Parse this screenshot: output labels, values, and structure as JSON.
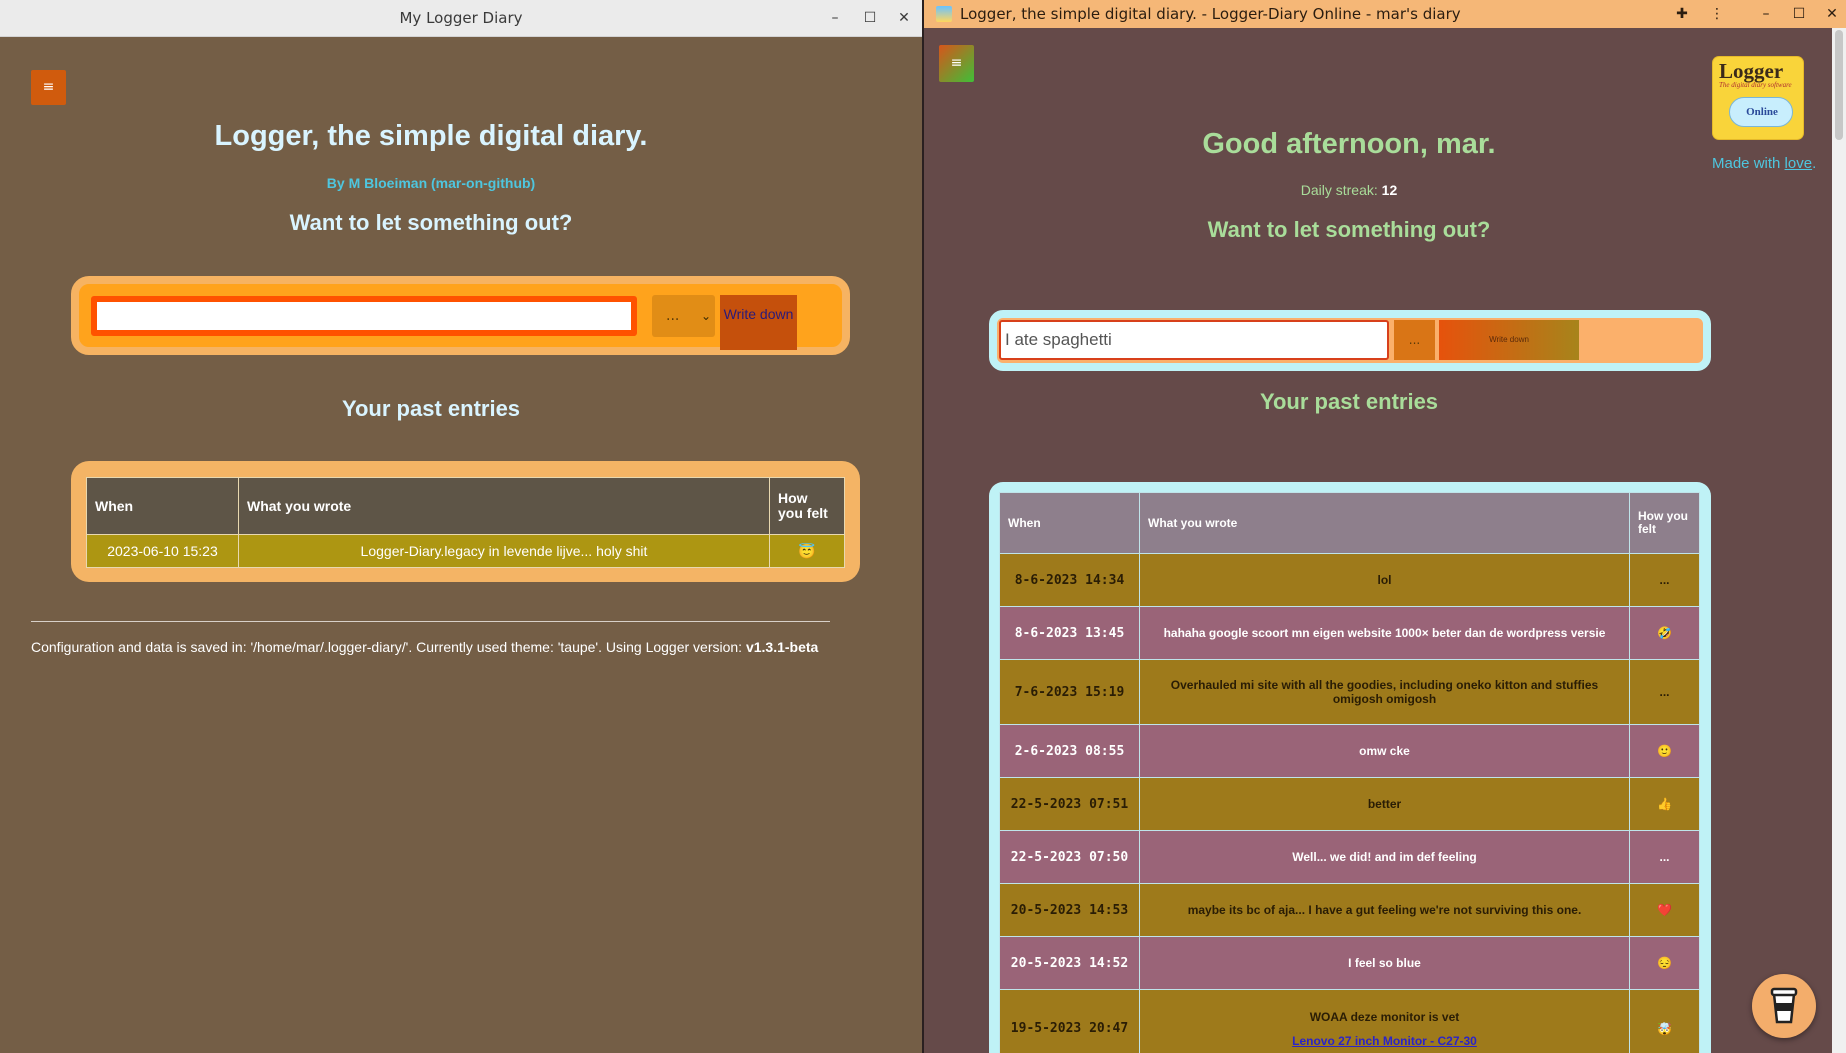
{
  "left_window": {
    "title": "My Logger Diary",
    "controls": {
      "minimize": "–",
      "maximize": "☐",
      "close": "✕"
    },
    "menu_icon": "≡",
    "heading": "Logger, the simple digital diary.",
    "author": "By M Bloeiman (mar-on-github)",
    "prompt": "Want to let something out?",
    "form": {
      "input_value": "",
      "mood_select": "...",
      "submit_label": "Write down"
    },
    "past_entries_heading": "Your past entries",
    "table": {
      "headers": [
        "When",
        "What you wrote",
        "How you felt"
      ],
      "rows": [
        {
          "when": "2023-06-10 15:23",
          "what": "Logger-Diary.legacy in levende lijve... holy shit",
          "felt": "😇"
        }
      ]
    },
    "footer": {
      "prefix": "Configuration and data is saved in: '/home/mar/.logger-diary/'. Currently used theme: 'taupe'. Using Logger version: ",
      "version": "v1.3.1-beta"
    }
  },
  "right_window": {
    "title": "Logger, the simple digital diary. - Logger-Diary Online - mar's diary",
    "controls": {
      "extensions": "✚",
      "menu": "⋮",
      "minimize": "–",
      "maximize": "☐",
      "close": "✕"
    },
    "menu_icon": "≡",
    "logo": {
      "title": "Logger",
      "tagline": "The digital diary software",
      "badge": "Online"
    },
    "made_with": {
      "prefix": "Made with ",
      "link": "love",
      "suffix": "."
    },
    "greeting": "Good afternoon, mar.",
    "streak": {
      "label": "Daily streak: ",
      "value": "12"
    },
    "prompt": "Want to let something out?",
    "form": {
      "input_value": "I ate spaghetti",
      "mood_select": "...",
      "submit_label": "Write down"
    },
    "past_entries_heading": "Your past entries",
    "table": {
      "headers": [
        "When",
        "What you wrote",
        "How you felt"
      ],
      "rows": [
        {
          "when": "8-6-2023 14:34",
          "what": "lol",
          "felt": "..."
        },
        {
          "when": "8-6-2023 13:45",
          "what": "hahaha google scoort mn eigen website 1000× beter dan de wordpress versie",
          "felt": "🤣"
        },
        {
          "when": "7-6-2023 15:19",
          "what": "Overhauled mi site with all the goodies, including oneko kitton and stuffies omigosh omigosh",
          "felt": "..."
        },
        {
          "when": "2-6-2023 08:55",
          "what": "omw cke",
          "felt": "🙂"
        },
        {
          "when": "22-5-2023 07:51",
          "what": "better",
          "felt": "👍"
        },
        {
          "when": "22-5-2023 07:50",
          "what": "Well... we did! and im def feeling",
          "felt": "..."
        },
        {
          "when": "20-5-2023 14:53",
          "what": "maybe its bc of aja... I have a gut feeling we're not surviving this one.",
          "felt": "❤️"
        },
        {
          "when": "20-5-2023 14:52",
          "what": "I feel so blue",
          "felt": "😔"
        },
        {
          "when": "19-5-2023 20:47",
          "what": "WOAA deze monitor is vet",
          "link": "Lenovo 27 inch Monitor - C27-30",
          "felt": "🤯"
        }
      ]
    },
    "coffee_icon": "☕"
  }
}
